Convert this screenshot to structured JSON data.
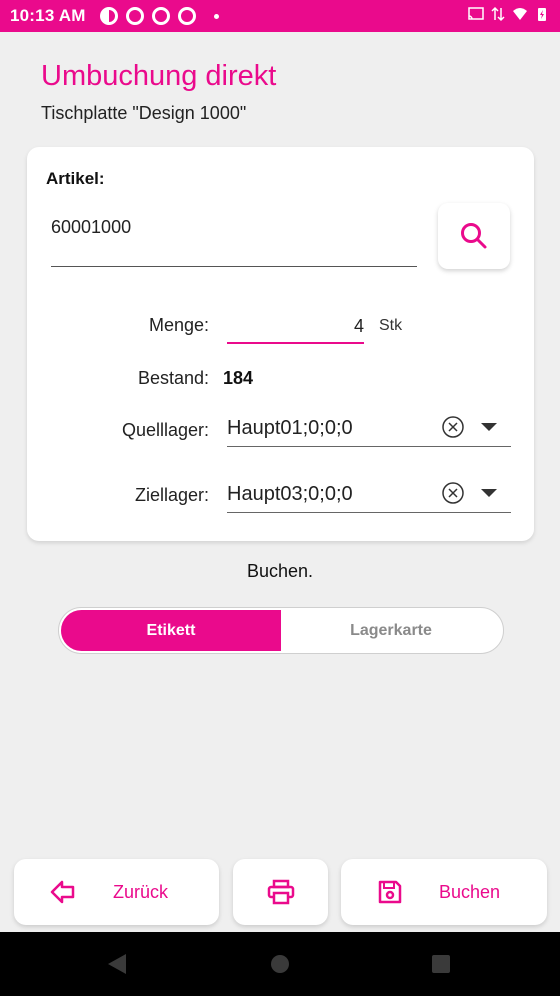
{
  "status_bar": {
    "time": "10:13 AM"
  },
  "header": {
    "title": "Umbuchung direkt",
    "subtitle": "Tischplatte \"Design 1000\""
  },
  "form": {
    "artikel_label": "Artikel:",
    "artikel_value": "60001000",
    "menge_label": "Menge:",
    "menge_value": "4",
    "menge_unit": "Stk",
    "bestand_label": "Bestand:",
    "bestand_value": "184",
    "quelllager_label": "Quelllager:",
    "quelllager_value": "Haupt01;0;0;0",
    "ziellager_label": "Ziellager:",
    "ziellager_value": "Haupt03;0;0;0"
  },
  "status_message": "Buchen.",
  "toggle": {
    "options": [
      "Etikett",
      "Lagerkarte"
    ],
    "selected": "Etikett"
  },
  "bottom_bar": {
    "back_label": "Zurück",
    "book_label": "Buchen"
  },
  "icons": {
    "search": "search-icon",
    "clear": "clear-circle-icon",
    "dropdown": "caret-down-icon",
    "back": "arrow-left-icon",
    "print": "printer-icon",
    "save": "floppy-disk-icon"
  },
  "colors": {
    "accent": "#ea0a8c",
    "background": "#efefef"
  }
}
